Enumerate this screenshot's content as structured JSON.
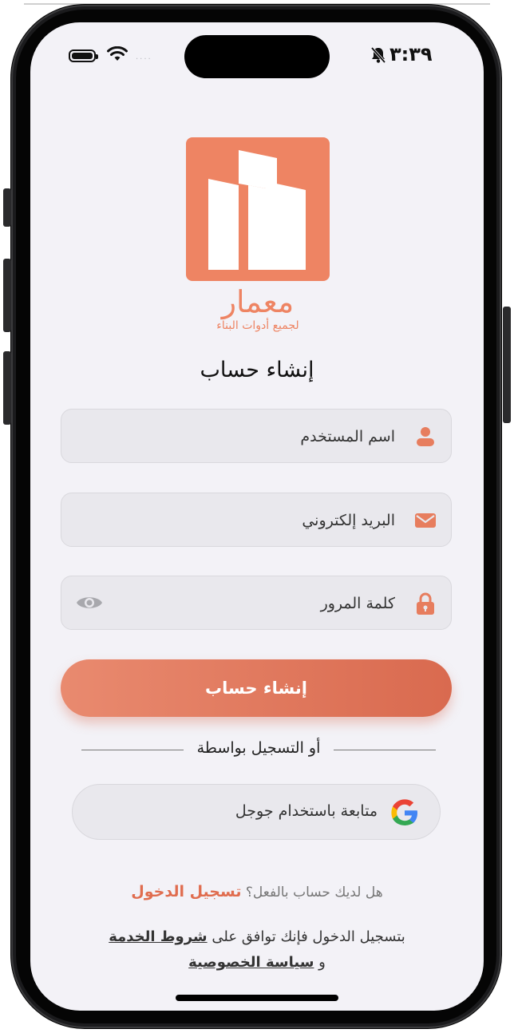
{
  "status_bar": {
    "time": "٣:٣٩",
    "signal_indicator": "....",
    "icons": [
      "battery-icon",
      "wifi-icon",
      "bell-slash-icon"
    ]
  },
  "logo": {
    "brand_name": "معمار",
    "tagline": "لجميع أدوات البناء"
  },
  "page_title": "إنشاء حساب",
  "form": {
    "username": {
      "placeholder": "اسم المستخدم",
      "value": "",
      "icon": "user-icon"
    },
    "email": {
      "placeholder": "البريد إلكتروني",
      "value": "",
      "icon": "envelope-icon"
    },
    "password": {
      "placeholder": "كلمة المرور",
      "value": "",
      "icon": "lock-icon",
      "toggle_icon": "eye-icon"
    },
    "submit_label": "إنشاء حساب"
  },
  "divider_text": "أو التسجيل بواسطة",
  "google_button": {
    "label": "متابعة باستخدام جوجل",
    "icon": "google-icon"
  },
  "login": {
    "prompt": "هل لديك حساب بالفعل؟",
    "link": "تسجيل الدخول"
  },
  "terms": {
    "prefix": "بتسجيل الدخول فإنك توافق على",
    "terms_link": "شروط الخدمة",
    "conjunction": "و",
    "privacy_link": "سياسة الخصوصية"
  },
  "colors": {
    "accent": "#ee8463",
    "button_start": "#e98a6f",
    "button_end": "#d96a4f",
    "screen_bg": "#f3f2f7",
    "field_bg": "#e9e8ed"
  }
}
